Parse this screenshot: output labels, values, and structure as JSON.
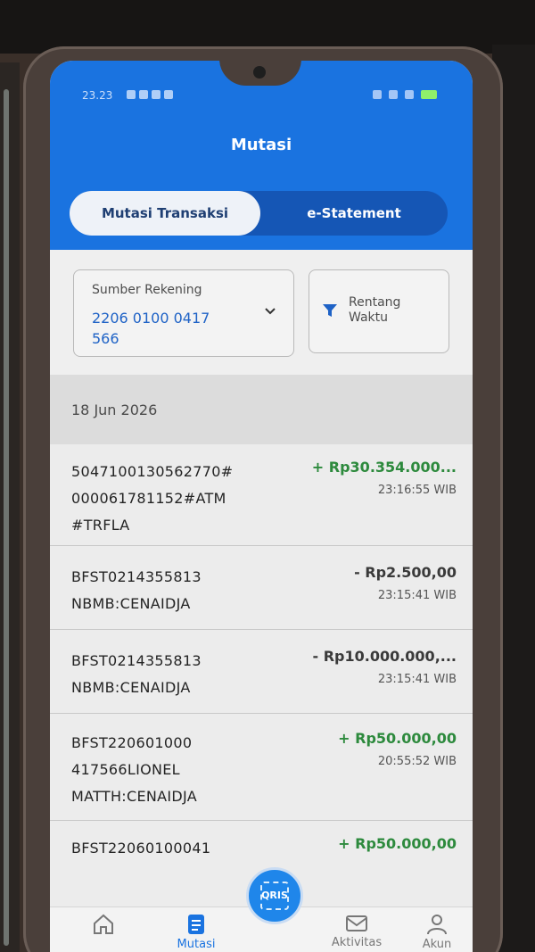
{
  "status_bar": {
    "time": "23.23"
  },
  "header": {
    "title": "Mutasi"
  },
  "tabs": [
    {
      "label": "Mutasi Transaksi",
      "active": true
    },
    {
      "label": "e-Statement",
      "active": false
    }
  ],
  "filters": {
    "source_label": "Sumber Rekening",
    "source_value": "2206 0100 0417 566",
    "range_label": "Rentang Waktu"
  },
  "date_header": "18 Jun 2026",
  "transactions": [
    {
      "description": "5047100130562770# 000061781152#ATM #TRFLA",
      "amount": "+ Rp30.354.000...",
      "time": "23:16:55 WIB",
      "type": "credit"
    },
    {
      "description": "BFST0214355813 NBMB:CENAIDJA",
      "amount": "- Rp2.500,00",
      "time": "23:15:41 WIB",
      "type": "debit"
    },
    {
      "description": "BFST0214355813 NBMB:CENAIDJA",
      "amount": "- Rp10.000.000,...",
      "time": "23:15:41 WIB",
      "type": "debit"
    },
    {
      "description": "BFST220601000 417566LIONEL MATTH:CENAIDJA",
      "amount": "+ Rp50.000,00",
      "time": "20:55:52 WIB",
      "type": "credit"
    },
    {
      "description": "BFST22060100041",
      "amount": "+ Rp50.000,00",
      "time": "",
      "type": "credit"
    }
  ],
  "bottom_nav": {
    "home": "",
    "mutasi": "Mutasi",
    "qris": "QRIS",
    "aktivitas": "Aktivitas",
    "akun": "Akun"
  },
  "colors": {
    "primary": "#1a73e0",
    "credit": "#2d8a3d",
    "debit": "#3a3a3a"
  }
}
